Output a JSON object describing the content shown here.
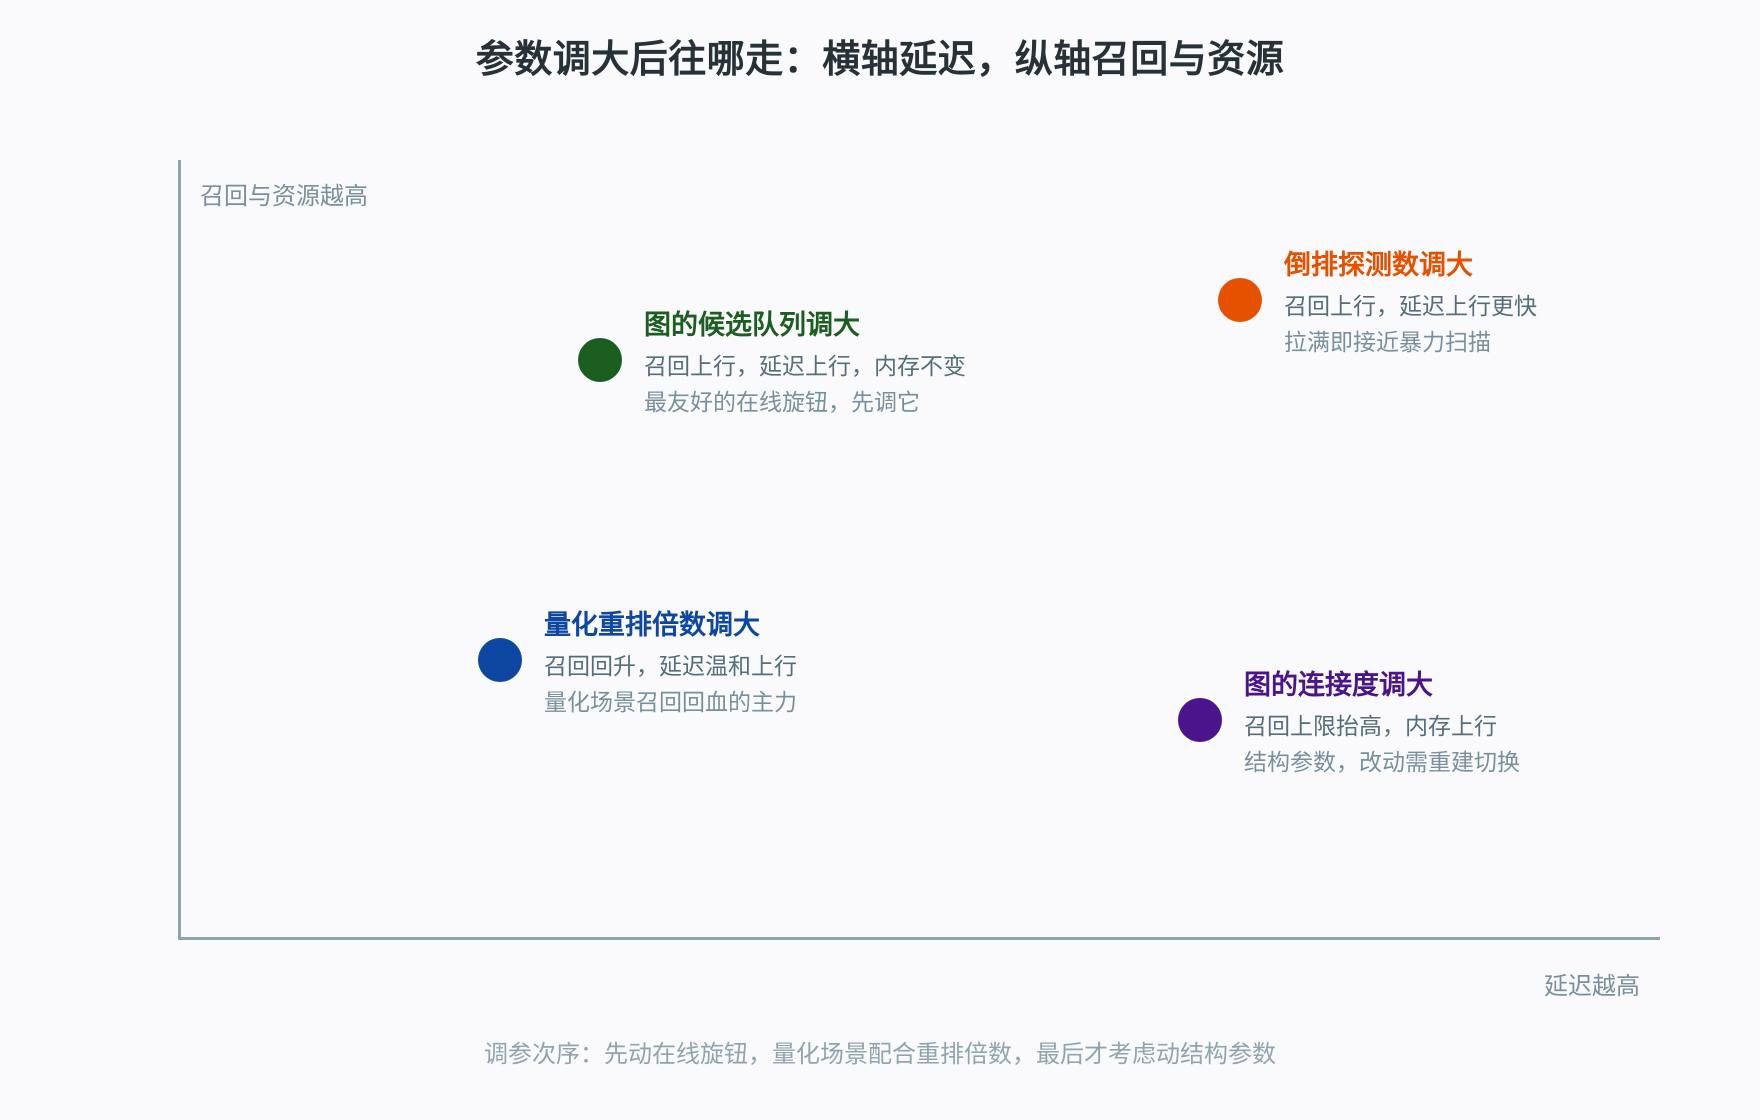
{
  "title": "参数调大后往哪走：横轴延迟，纵轴召回与资源",
  "axes": {
    "y_label": "召回与资源越高",
    "x_label": "延迟越高"
  },
  "points": [
    {
      "title": "图的候选队列调大",
      "line1": "召回上行，延迟上行，内存不变",
      "line2": "最友好的在线旋钮，先调它",
      "color": "#1b5e20"
    },
    {
      "title": "倒排探测数调大",
      "line1": "召回上行，延迟上行更快",
      "line2": "拉满即接近暴力扫描",
      "color": "#e65100"
    },
    {
      "title": "量化重排倍数调大",
      "line1": "召回回升，延迟温和上行",
      "line2": "量化场景召回回血的主力",
      "color": "#0d47a1"
    },
    {
      "title": "图的连接度调大",
      "line1": "召回上限抬高，内存上行",
      "line2": "结构参数，改动需重建切换",
      "color": "#4a148c"
    }
  ],
  "footer": "调参次序：先动在线旋钮，量化场景配合重排倍数，最后才考虑动结构参数"
}
